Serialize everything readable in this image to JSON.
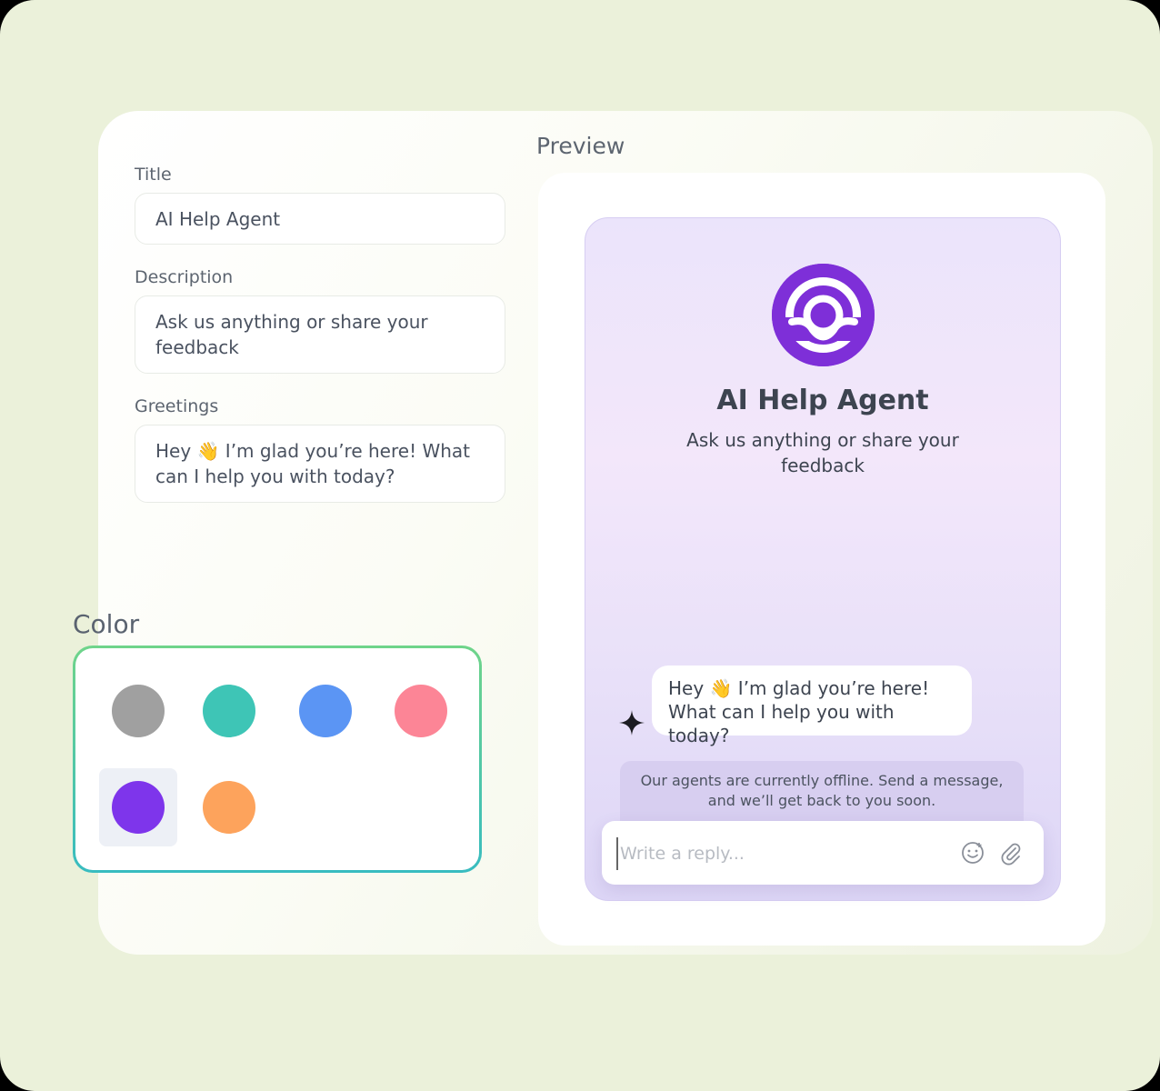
{
  "form": {
    "title_label": "Title",
    "title_value": "AI Help Agent",
    "description_label": "Description",
    "description_value": "Ask us anything or share your feedback",
    "greetings_label": "Greetings",
    "greetings_value": "Hey 👋 I’m glad you’re here! What can I help you with today?"
  },
  "color": {
    "label": "Color",
    "swatches": [
      {
        "name": "gray",
        "hex": "#a0a0a0",
        "selected": false
      },
      {
        "name": "teal",
        "hex": "#3ec5b6",
        "selected": false
      },
      {
        "name": "blue",
        "hex": "#5b95f4",
        "selected": false
      },
      {
        "name": "pink",
        "hex": "#fc8596",
        "selected": false
      },
      {
        "name": "purple",
        "hex": "#7e35eb",
        "selected": true
      },
      {
        "name": "orange",
        "hex": "#fda35c",
        "selected": false
      }
    ]
  },
  "preview": {
    "heading": "Preview",
    "agent_title": "AI Help Agent",
    "agent_description": "Ask us anything or share your feedback",
    "greeting_bubble": "Hey 👋 I’m glad you’re here! What can I help you with today?",
    "offline_notice": "Our agents are currently offline. Send a message, and we’ll get back to you soon.",
    "reply_placeholder": "Write a reply...",
    "accent_color": "#7e2fd8",
    "icons": [
      "agent-logo-icon",
      "sparkle-icon",
      "emoji-icon",
      "paperclip-icon"
    ]
  }
}
